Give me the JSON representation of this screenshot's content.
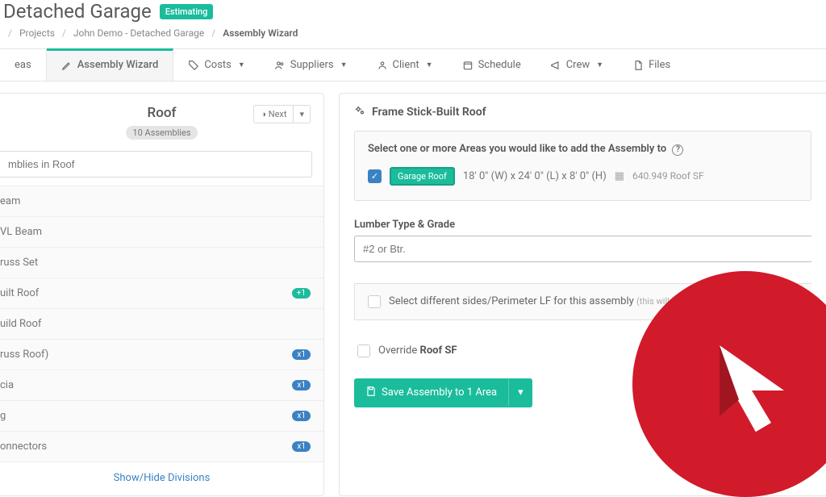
{
  "header": {
    "title": "Detached Garage",
    "badge": "Estimating"
  },
  "breadcrumb": {
    "projects": "Projects",
    "project": "John Demo - Detached Garage",
    "current": "Assembly Wizard"
  },
  "tabs": {
    "areas": "eas",
    "wizard": "Assembly Wizard",
    "costs": "Costs",
    "suppliers": "Suppliers",
    "client": "Client",
    "schedule": "Schedule",
    "crew": "Crew",
    "files": "Files"
  },
  "left": {
    "title": "Roof",
    "subtitle": "10 Assemblies",
    "next": "Next",
    "search_placeholder": "mblies in Roof",
    "items": [
      {
        "label": "eam",
        "pill": ""
      },
      {
        "label": "VL Beam",
        "pill": ""
      },
      {
        "label": "russ Set",
        "pill": ""
      },
      {
        "label": "uilt Roof",
        "pill": "+1",
        "pill_cls": "pill-green"
      },
      {
        "label": "uild Roof",
        "pill": ""
      },
      {
        "label": "russ Roof)",
        "pill": "x1",
        "pill_cls": "pill-blue"
      },
      {
        "label": "cia",
        "pill": "x1",
        "pill_cls": "pill-blue"
      },
      {
        "label": "g",
        "pill": "x1",
        "pill_cls": "pill-blue"
      },
      {
        "label": "onnectors",
        "pill": "x1",
        "pill_cls": "pill-blue"
      }
    ],
    "show_hide": "Show/Hide Divisions"
  },
  "right": {
    "title": "Frame Stick-Built Roof",
    "area_head": "Select one or more Areas you would like to add the Assembly to",
    "area_tag": "Garage Roof",
    "area_dims": "18' 0\" (W) x 24' 0\" (L) x 8' 0\" (H)",
    "area_calc": "640.949 Roof SF",
    "lumber_label": "Lumber Type & Grade",
    "lumber_value": "#2 or Btr.",
    "opt_label": "Select different sides/Perimeter LF for this assembly",
    "opt_hint": "(this will not affect the ar",
    "override_prefix": "Override ",
    "override_bold": "Roof SF",
    "save": "Save Assembly to 1 Area"
  }
}
